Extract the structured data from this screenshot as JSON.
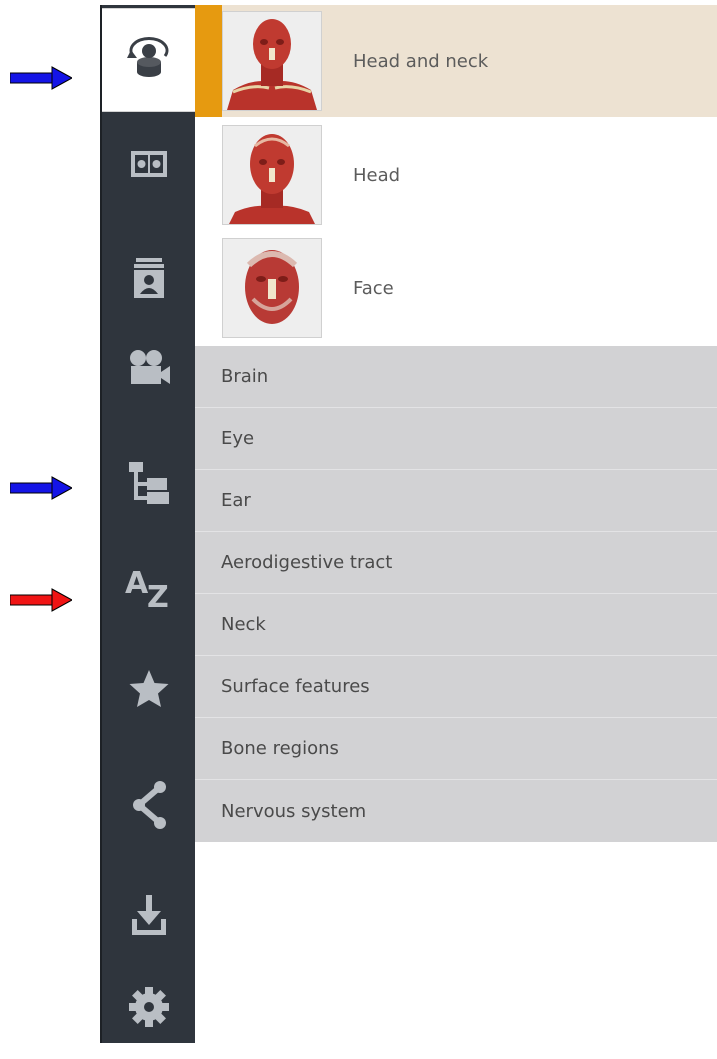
{
  "annotation_arrows": [
    {
      "name": "blue-arrow",
      "color": "#1414e6"
    },
    {
      "name": "blue-arrow",
      "color": "#1414e6"
    },
    {
      "name": "red-arrow",
      "color": "#f01414"
    }
  ],
  "sidebar": {
    "background": "#2f353d",
    "icon_color": "#b9bec4",
    "items": [
      {
        "icon": "rotate-model-icon",
        "active": true
      },
      {
        "icon": "split-view-icon"
      },
      {
        "icon": "layers-person-icon"
      },
      {
        "icon": "video-camera-icon"
      },
      {
        "icon": "tree-hierarchy-icon"
      },
      {
        "icon": "alphabetical-az-icon",
        "text": "AZ"
      },
      {
        "icon": "star-icon"
      },
      {
        "icon": "share-icon"
      },
      {
        "icon": "download-icon"
      },
      {
        "icon": "gear-icon"
      }
    ]
  },
  "content": {
    "accent": "#e69a10",
    "selected_background": "#ede2d2",
    "subregions": [
      {
        "label": "Head and neck",
        "selected": true
      },
      {
        "label": "Head"
      },
      {
        "label": "Face"
      }
    ],
    "categories": [
      "Brain",
      "Eye",
      "Ear",
      "Aerodigestive tract",
      "Neck",
      "Surface features",
      "Bone regions",
      "Nervous system"
    ]
  }
}
